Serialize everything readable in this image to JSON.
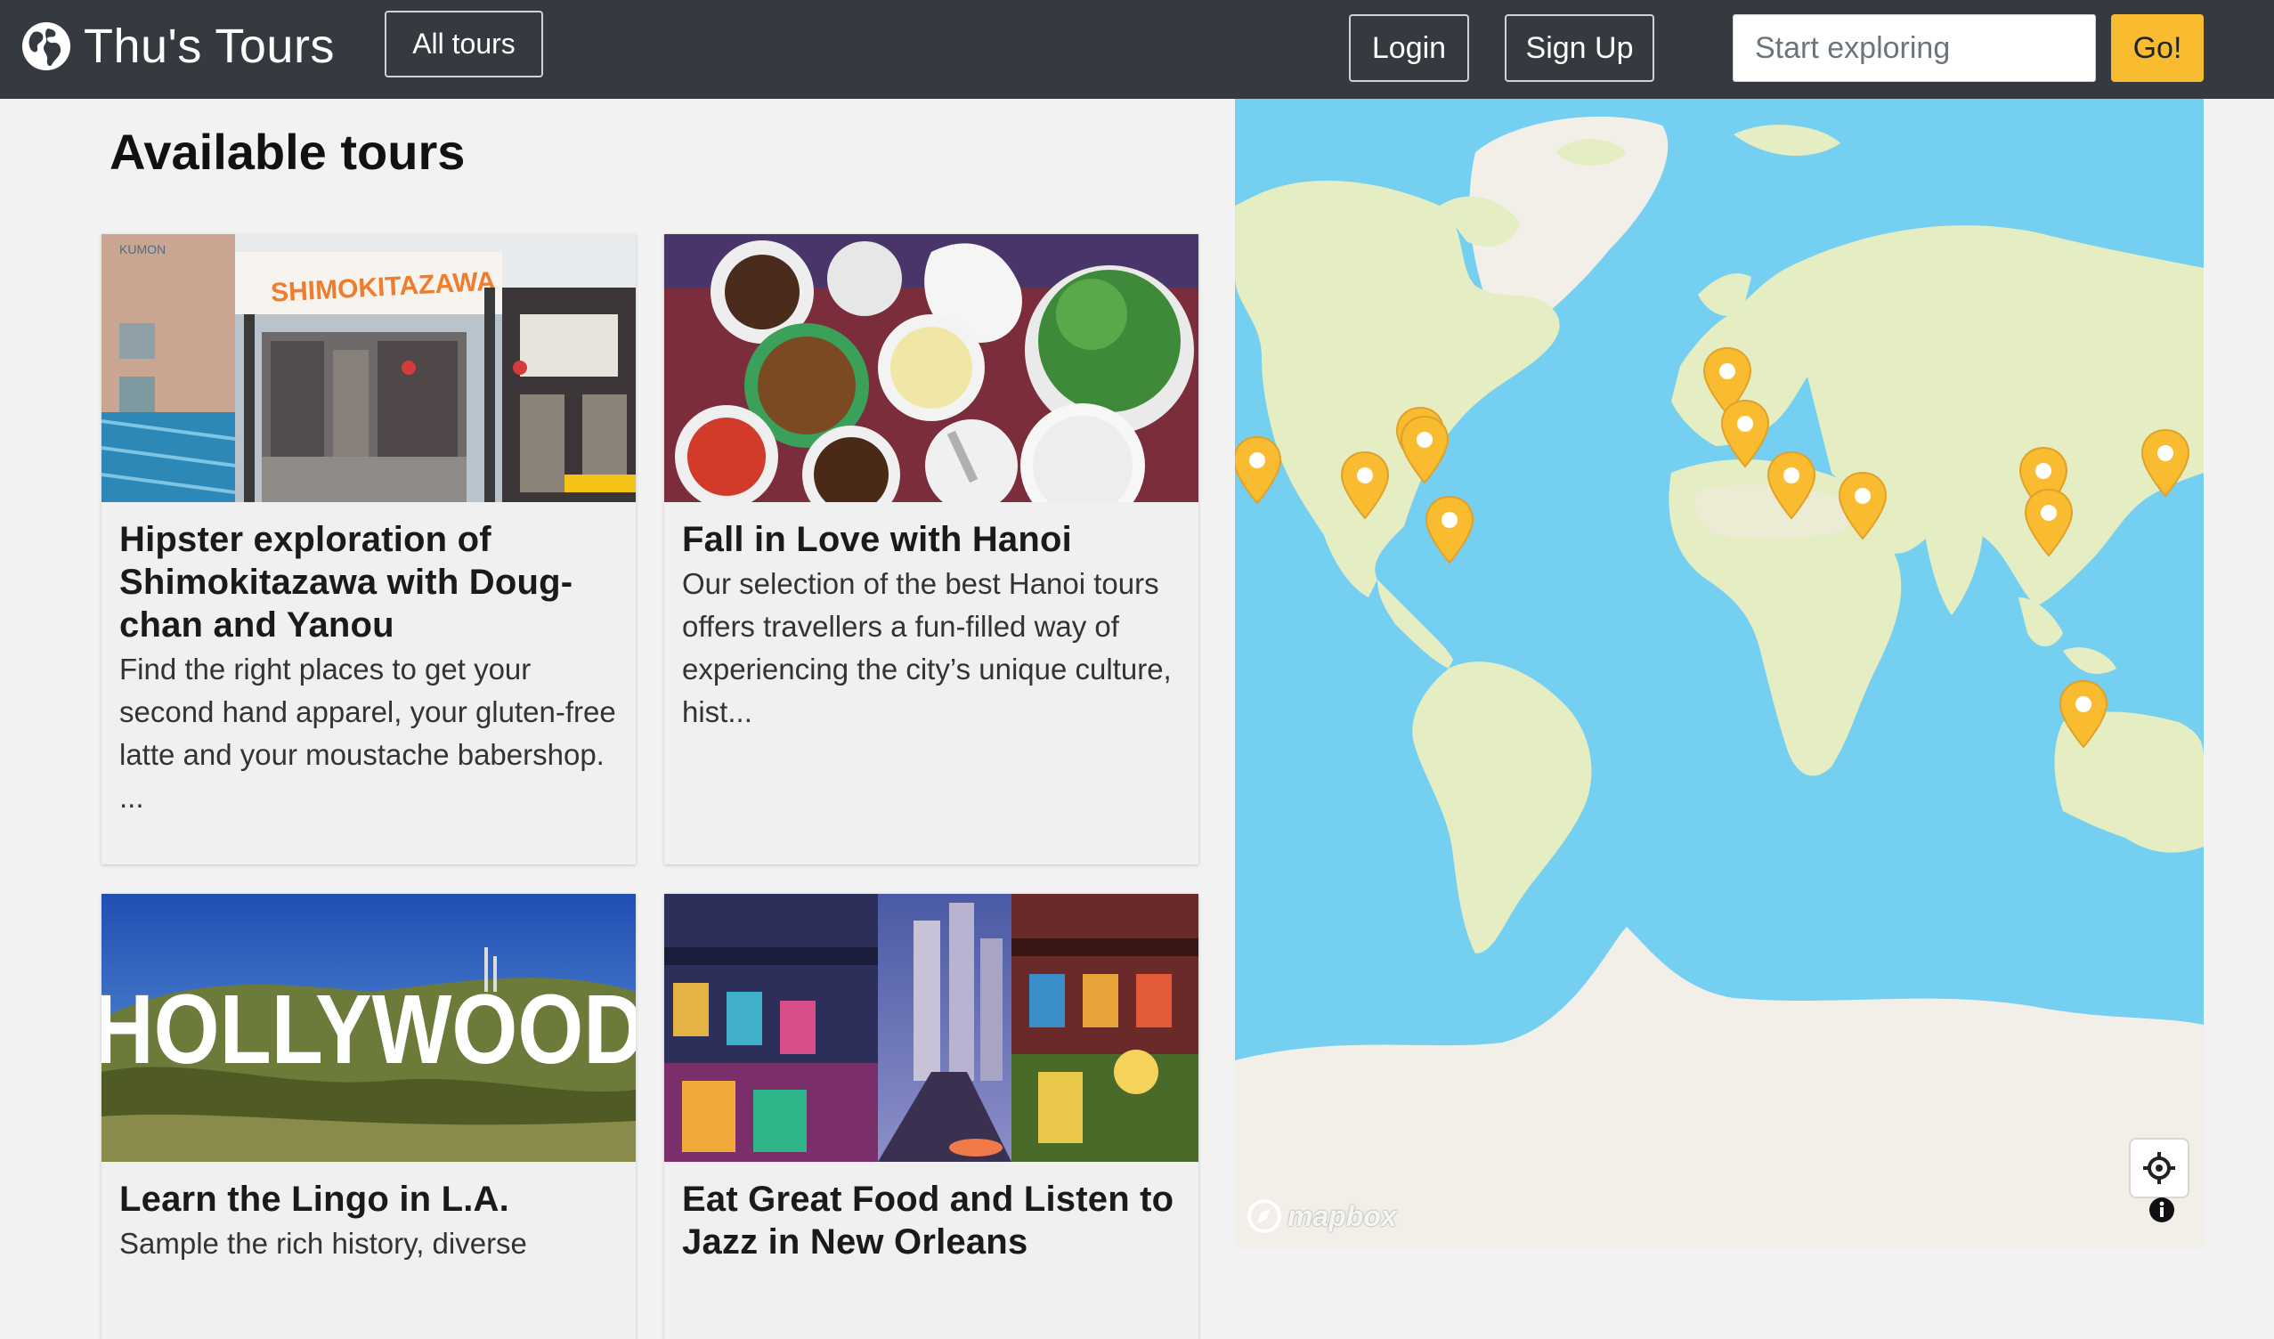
{
  "navbar": {
    "brand": "Thu's Tours",
    "all_tours": "All tours",
    "login": "Login",
    "signup": "Sign Up",
    "search_placeholder": "Start exploring",
    "go": "Go!"
  },
  "page": {
    "title": "Available tours"
  },
  "tours": [
    {
      "title": "Hipster exploration of Shimokitazawa with Doug-chan and Yanou",
      "desc": "Find the right places to get your second hand apparel, your gluten-free latte and your moustache babershop. ...",
      "sign": "SHIMOKITAZAWA",
      "sign2": "KUMON"
    },
    {
      "title": "Fall in Love with Hanoi",
      "desc": "Our selection of the best Hanoi tours offers travellers a fun-filled way of experiencing the city’s unique culture, hist..."
    },
    {
      "title": "Learn the Lingo in L.A.",
      "desc": "Sample the rich history, diverse",
      "sign": "HOLLYWOOD"
    },
    {
      "title": "Eat Great Food and Listen to Jazz in New Orleans",
      "desc": ""
    }
  ],
  "map": {
    "attribution": "mapbox",
    "ocean_color": "#75cff0",
    "land_color": "#e4eec2",
    "ice_color": "#f2efe9",
    "pin_color": "#f9bb2f"
  },
  "colors": {
    "navbar": "#343a40",
    "accent": "#f9bb2f",
    "background": "#f3f2f2"
  }
}
